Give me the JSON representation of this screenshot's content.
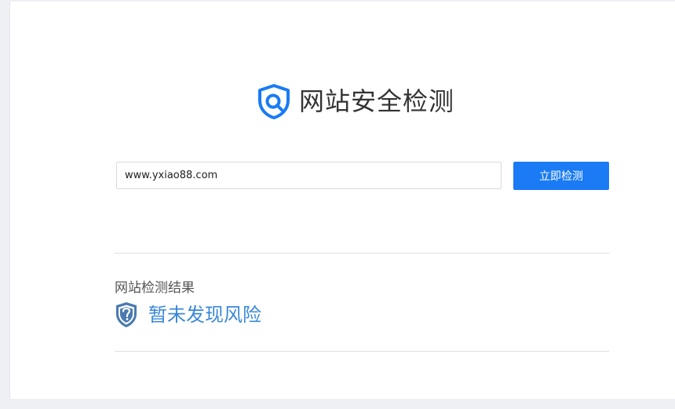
{
  "header": {
    "title": "网站安全检测",
    "logo_icon": "shield-search-icon"
  },
  "search": {
    "value": "www.yxiao88.com",
    "button_label": "立即检测"
  },
  "result": {
    "label": "网站检测结果",
    "status": "暂未发现风险",
    "status_icon": "shield-question-icon"
  },
  "colors": {
    "accent": "#1a7bf5",
    "status": "#3a88d8",
    "shield": "#4a7ab0"
  }
}
